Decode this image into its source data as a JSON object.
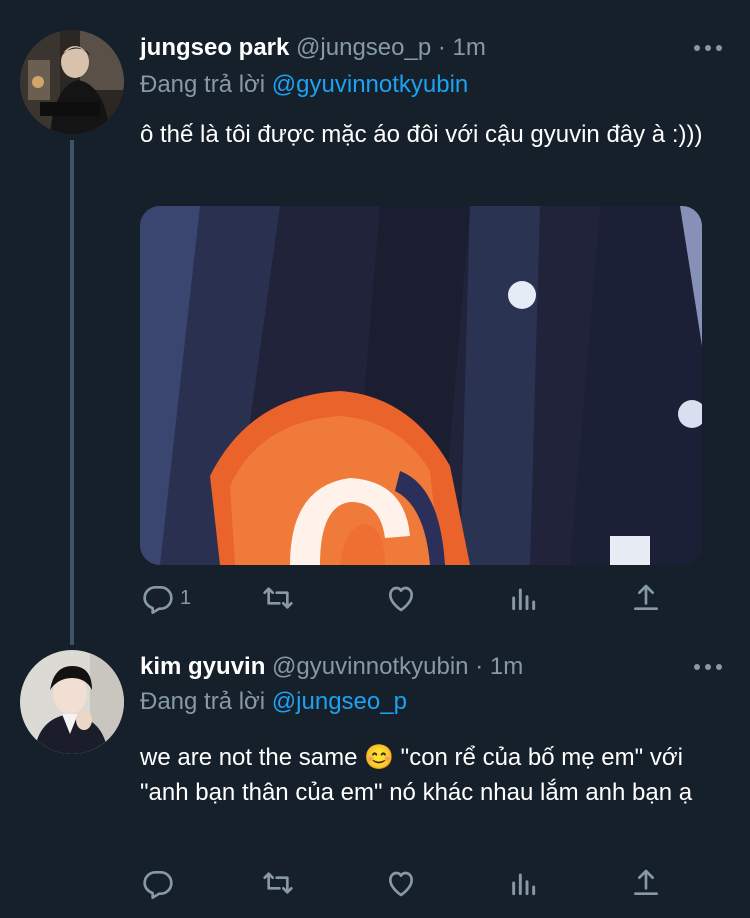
{
  "tweets": [
    {
      "name": "jungseo park",
      "handle": "@jungseo_p",
      "separator": "·",
      "time": "1m",
      "replying_prefix": "Đang trả lời",
      "replying_to": "@gyuvinnotkyubin",
      "text": "ô thế là tôi được mặc áo đôi với cậu gyuvin đây à :)))",
      "reply_count": "1",
      "icons": [
        "reply-icon",
        "retweet-icon",
        "like-icon",
        "analytics-icon",
        "share-icon"
      ]
    },
    {
      "name": "kim gyuvin",
      "handle": "@gyuvinnotkyubin",
      "separator": "·",
      "time": "1m",
      "replying_prefix": "Đang trả lời",
      "replying_to": "@jungseo_p",
      "text": "we are not the same 😊  \"con rể của bố mẹ em\" với \"anh bạn thân của em\" nó khác nhau lắm anh bạn ạ",
      "reply_count": "",
      "icons": [
        "reply-icon",
        "retweet-icon",
        "like-icon",
        "analytics-icon",
        "share-icon"
      ]
    }
  ],
  "colors": {
    "background": "#15202b",
    "text": "#ffffff",
    "secondary": "#8899a6",
    "link": "#1da1f2",
    "thread_line": "#3d5466"
  }
}
